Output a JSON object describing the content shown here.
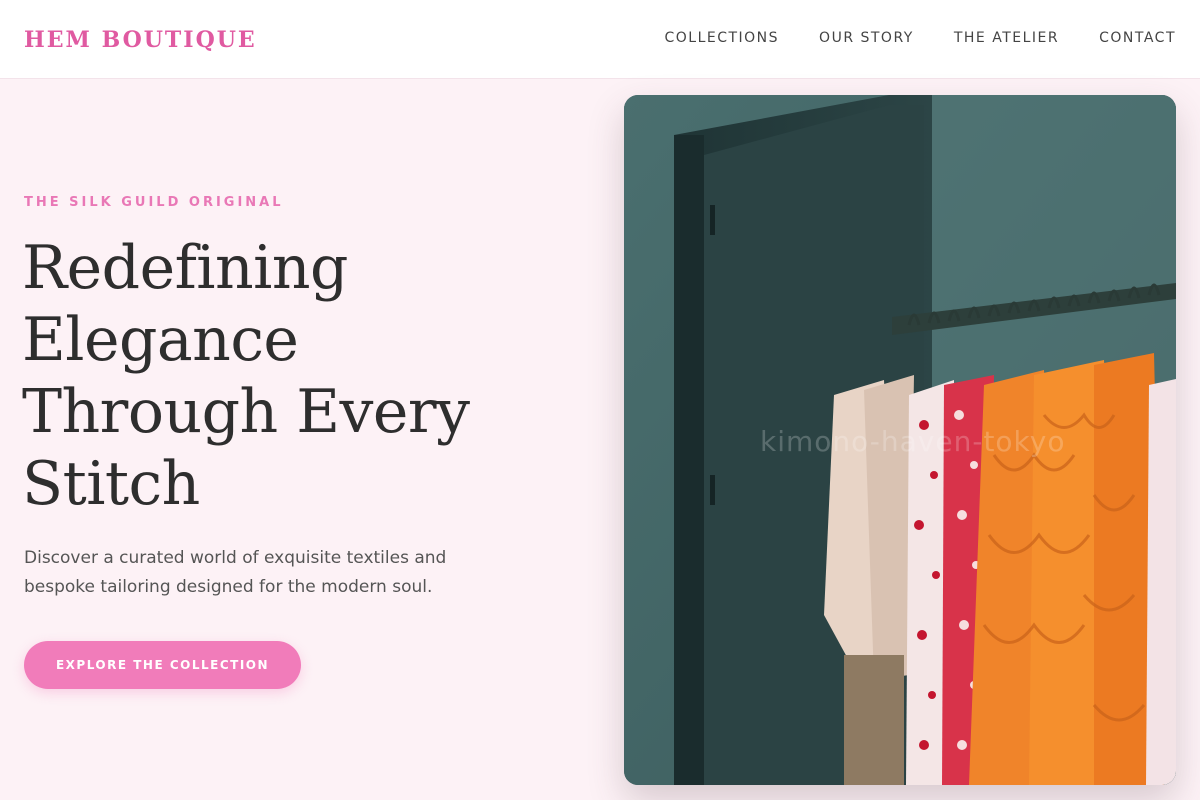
{
  "brand": {
    "name": "HEM BOUTIQUE",
    "accent": "#e05aa1"
  },
  "nav": {
    "items": [
      {
        "label": "COLLECTIONS"
      },
      {
        "label": "OUR STORY"
      },
      {
        "label": "THE ATELIER"
      },
      {
        "label": "CONTACT"
      }
    ]
  },
  "hero": {
    "eyebrow": "THE SILK GUILD ORIGINAL",
    "headline_lines": [
      "Redefining",
      "Elegance",
      "Through Every",
      "Stitch"
    ],
    "subtext": "Discover a curated world of exquisite textiles and bespoke tailoring designed for the modern soul.",
    "cta_label": "EXPLORE THE COLLECTION",
    "cta_color": "#f17cba",
    "image_watermark": "kimono-haven-tokyo"
  },
  "colors": {
    "background": "#fdf2f6",
    "heading": "#2e2e2e",
    "eyebrow": "#e978b6"
  }
}
